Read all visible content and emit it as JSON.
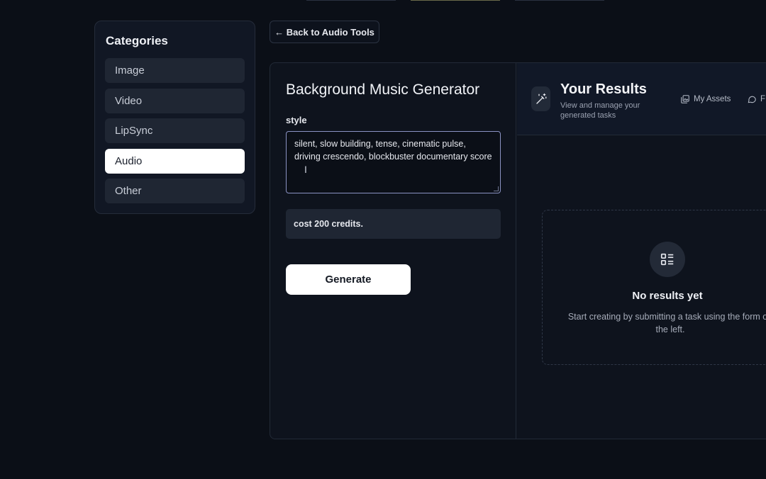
{
  "sidebar": {
    "title": "Categories",
    "items": [
      {
        "label": "Image",
        "active": false
      },
      {
        "label": "Video",
        "active": false
      },
      {
        "label": "LipSync",
        "active": false
      },
      {
        "label": "Audio",
        "active": true
      },
      {
        "label": "Other",
        "active": false
      }
    ]
  },
  "nav": {
    "back_label": "← Back to Audio Tools"
  },
  "form": {
    "title": "Background Music Generator",
    "style_label": "style",
    "style_value": "silent, slow building, tense, cinematic pulse, driving crescendo, blockbuster documentary score",
    "cost_text": "cost 200 credits.",
    "generate_label": "Generate"
  },
  "results": {
    "title": "Your Results",
    "subtitle": "View and manage your generated tasks",
    "my_assets_label": "My Assets",
    "second_link_label": "F",
    "empty_title": "No results yet",
    "empty_desc": "Start creating by submitting a task using the form on the left."
  },
  "icons": {
    "wand": "magic-wand-icon",
    "assets": "image-stack-icon",
    "chat": "chat-bubble-icon",
    "list": "list-icon",
    "cursor": "text-cursor-icon"
  },
  "colors": {
    "background": "#0b0f17",
    "panel": "#111724",
    "active_item": "#ffffff",
    "textarea_border": "#8b93c4"
  }
}
